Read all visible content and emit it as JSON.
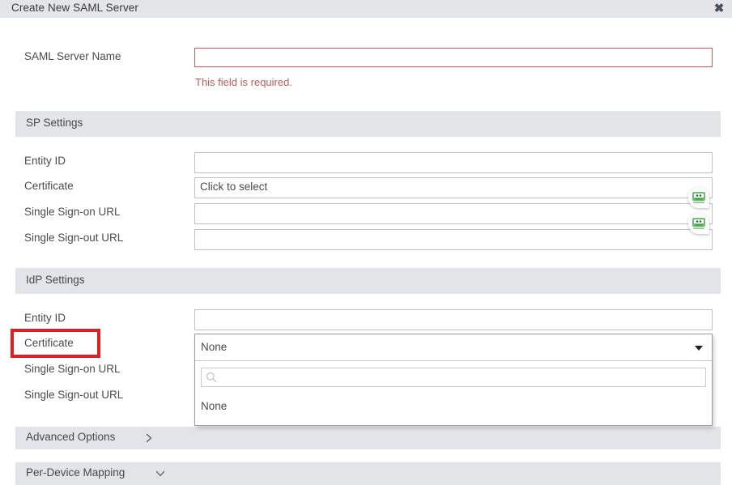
{
  "window": {
    "title": "Create New SAML Server",
    "close_label": "✖"
  },
  "top_field": {
    "label": "SAML Server Name",
    "value": "",
    "placeholder": "",
    "error": "This field is required."
  },
  "sp_section": {
    "title": "SP Settings",
    "rows": [
      {
        "label": "Entity ID",
        "value": "",
        "type": "text"
      },
      {
        "label": "Certificate",
        "value": "Click to select",
        "type": "picker"
      },
      {
        "label": "Single Sign-on URL",
        "value": "",
        "type": "text"
      },
      {
        "label": "Single Sign-out URL",
        "value": "",
        "type": "text"
      }
    ]
  },
  "idp_section": {
    "title": "IdP Settings",
    "rows": [
      {
        "label": "Entity ID",
        "value": "",
        "type": "text"
      },
      {
        "label": "Certificate",
        "value": "None",
        "type": "select"
      },
      {
        "label": "Single Sign-on URL",
        "value": "",
        "type": "text"
      },
      {
        "label": "Single Sign-out URL",
        "value": "",
        "type": "text"
      }
    ]
  },
  "dropdown": {
    "selected": "None",
    "search_value": "",
    "search_placeholder": "",
    "search_icon": "search-icon",
    "caret_icon": "chevron-down-icon",
    "options": [
      "None"
    ]
  },
  "footer": {
    "advanced": {
      "label": "Advanced Options",
      "icon": "chevron-right-icon"
    },
    "per_device": {
      "label": "Per-Device Mapping",
      "icon": "chevron-down-icon"
    }
  },
  "autofill": {
    "icon": "password-manager-robot-icon",
    "count": 2
  },
  "colors": {
    "titlebar_bg": "#e4e5e8",
    "band_bg": "#e3e4e7",
    "error_text": "#bb5b59",
    "error_border": "#bd5f5d",
    "annotation": "#e02020",
    "autofill_green": "#4caf50",
    "text": "#4b4b4d"
  }
}
